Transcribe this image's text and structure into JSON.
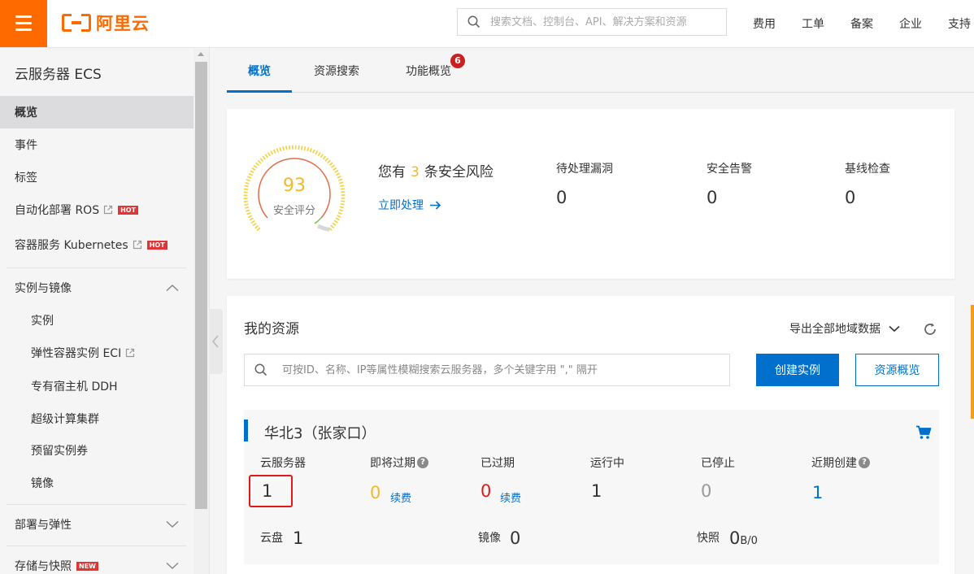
{
  "header": {
    "brand": "阿里云",
    "search_placeholder": "搜索文档、控制台、API、解决方案和资源",
    "nav": [
      "费用",
      "工单",
      "备案",
      "企业",
      "支持"
    ]
  },
  "sidebar": {
    "title": "云服务器 ECS",
    "items": [
      {
        "label": "概览"
      },
      {
        "label": "事件"
      },
      {
        "label": "标签"
      },
      {
        "label": "自动化部署 ROS",
        "badge": "HOT"
      },
      {
        "label": "容器服务 Kubernetes",
        "badge": "HOT"
      }
    ],
    "group_instances": {
      "label": "实例与镜像",
      "items": [
        "实例",
        "弹性容器实例 ECI",
        "专有宿主机 DDH",
        "超级计算集群",
        "预留实例券",
        "镜像"
      ]
    },
    "group_deploy": {
      "label": "部署与弹性"
    },
    "group_storage": {
      "label": "存储与快照",
      "badge": "NEW"
    }
  },
  "tabs": [
    {
      "label": "概览"
    },
    {
      "label": "资源搜索"
    },
    {
      "label": "功能概览",
      "badge": "6"
    }
  ],
  "security": {
    "score": "93",
    "score_label": "安全评分",
    "risk_prefix": "您有",
    "risk_count": "3",
    "risk_suffix": "条安全风险",
    "action_link": "立即处理",
    "stats": [
      {
        "label": "待处理漏洞",
        "value": "0"
      },
      {
        "label": "安全告警",
        "value": "0"
      },
      {
        "label": "基线检查",
        "value": "0"
      }
    ]
  },
  "resources": {
    "title": "我的资源",
    "export_label": "导出全部地域数据",
    "search_placeholder": "可按ID、名称、IP等属性模糊搜索云服务器，多个关键字用 \",\" 隔开",
    "create_button": "创建实例",
    "overview_button": "资源概览",
    "region": {
      "name": "华北3（张家口）",
      "servers_label": "云服务器",
      "servers_value": "1",
      "expiring_label": "即将过期",
      "expiring_value": "0",
      "expiring_action": "续费",
      "expired_label": "已过期",
      "expired_value": "0",
      "expired_action": "续费",
      "running_label": "运行中",
      "running_value": "1",
      "stopped_label": "已停止",
      "stopped_value": "0",
      "recent_label": "近期创建",
      "recent_value": "1",
      "disk_label": "云盘",
      "disk_value": "1",
      "image_label": "镜像",
      "image_value": "0",
      "snapshot_label": "快照",
      "snapshot_value": "0",
      "snapshot_unit": "B/0"
    }
  },
  "colors": {
    "brand": "#ff6a00",
    "primary": "#0070cc",
    "score": "#f2b92c",
    "danger": "#e31919"
  }
}
